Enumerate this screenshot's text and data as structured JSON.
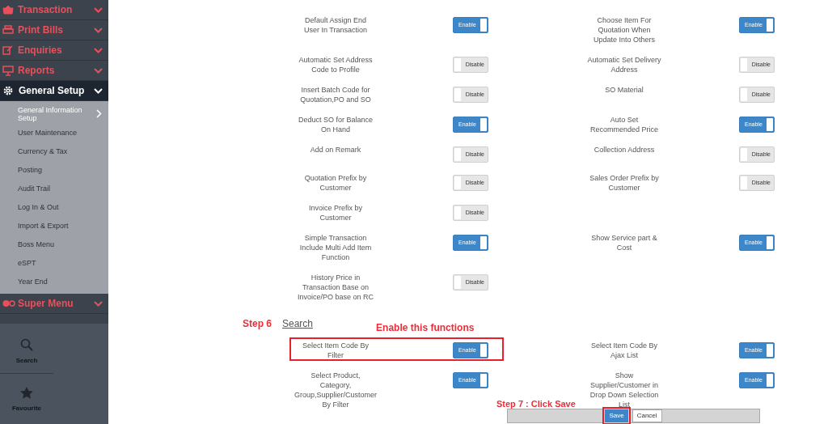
{
  "sidebar": {
    "menu": [
      {
        "label": "Transaction",
        "expanded": false
      },
      {
        "label": "Print Bills",
        "expanded": false
      },
      {
        "label": "Enquiries",
        "expanded": false
      },
      {
        "label": "Reports",
        "expanded": false
      },
      {
        "label": "General Setup",
        "expanded": true,
        "children": [
          {
            "label": "General Information Setup",
            "selected": true
          },
          {
            "label": "User Maintenance",
            "selected": false
          },
          {
            "label": "Currency & Tax",
            "selected": false
          },
          {
            "label": "Posting",
            "selected": false
          },
          {
            "label": "Audit Trail",
            "selected": false
          },
          {
            "label": "Log In & Out",
            "selected": false
          },
          {
            "label": "Import & Export",
            "selected": false
          },
          {
            "label": "Boss Menu",
            "selected": false
          },
          {
            "label": "eSPT",
            "selected": false
          },
          {
            "label": "Year End",
            "selected": false
          }
        ]
      },
      {
        "label": "Super Menu",
        "expanded": false
      }
    ],
    "bottom": [
      {
        "label": "Search"
      },
      {
        "label": "Favourite"
      }
    ]
  },
  "settings": [
    {
      "left": {
        "label": "Default Assign End\nUser In Transaction",
        "on": true,
        "toggle_text": "Enable"
      },
      "right": {
        "label": "Choose Item For\nQuotation When\nUpdate Into Others",
        "on": true,
        "toggle_text": "Enable"
      }
    },
    {
      "left": {
        "label": "Automatic Set Address\nCode to Profile",
        "on": false,
        "toggle_text": "Disable"
      },
      "right": {
        "label": "Automatic Set Delivery\nAddress",
        "on": false,
        "toggle_text": "Disable"
      }
    },
    {
      "left": {
        "label": "Insert Batch Code for\nQuotation,PO and SO",
        "on": false,
        "toggle_text": "Disable"
      },
      "right": {
        "label": "SO Material",
        "on": false,
        "toggle_text": "Disable"
      }
    },
    {
      "left": {
        "label": "Deduct SO for Balance\nOn Hand",
        "on": true,
        "toggle_text": "Enable"
      },
      "right": {
        "label": "Auto Set\nRecommended Price",
        "on": true,
        "toggle_text": "Enable"
      }
    },
    {
      "left": {
        "label": "Add on Remark",
        "on": false,
        "toggle_text": "Disable"
      },
      "right": {
        "label": "Collection Address",
        "on": false,
        "toggle_text": "Disable"
      }
    },
    {
      "left": {
        "label": "Quotation Prefix by\nCustomer",
        "on": false,
        "toggle_text": "Disable"
      },
      "right": {
        "label": "Sales Order Prefix by\nCustomer",
        "on": false,
        "toggle_text": "Disable"
      }
    },
    {
      "left": {
        "label": "Invoice Prefix by\nCustomer",
        "on": false,
        "toggle_text": "Disable"
      }
    },
    {
      "left": {
        "label": "Simple Transaction\nInclude Multi Add Item\nFunction",
        "on": true,
        "toggle_text": "Enable"
      },
      "right": {
        "label": "Show Service part &\nCost",
        "on": true,
        "toggle_text": "Enable"
      }
    },
    {
      "left": {
        "label": "History Price in\nTransaction Base on\nInvoice/PO base on RC",
        "on": false,
        "toggle_text": "Disable"
      }
    }
  ],
  "search_section": {
    "step": "Step 6",
    "link": "Search",
    "callout": "Enable this functions",
    "settings": [
      {
        "highlighted": true,
        "left": {
          "label": "Select Item Code By\nFilter",
          "on": true,
          "toggle_text": "Enable"
        },
        "right": {
          "label": "Select Item Code By\nAjax List",
          "on": true,
          "toggle_text": "Enable"
        }
      },
      {
        "highlighted": false,
        "left": {
          "label": "Select Product,\nCategory,\nGroup,Supplier/Customer\nBy Filter",
          "on": true,
          "toggle_text": "Enable"
        },
        "right": {
          "label": "Show\nSupplier/Customer in\nDrop Down Selection\nList",
          "on": true,
          "toggle_text": "Enable"
        }
      }
    ]
  },
  "footer": {
    "step": "Step 7 : Click Save",
    "buttons": [
      {
        "label": "Save",
        "kind": "primary",
        "highlighted": true
      },
      {
        "label": "Cancel",
        "kind": "secondary",
        "highlighted": false
      }
    ]
  }
}
